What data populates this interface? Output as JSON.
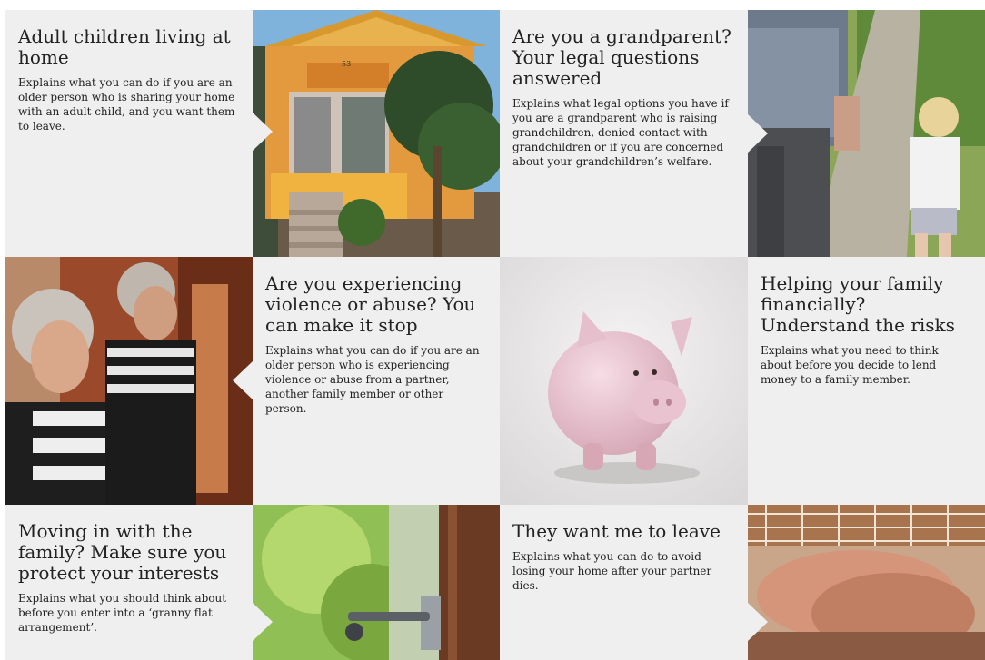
{
  "cards": [
    {
      "title": "Adult children living at home",
      "desc": "Explains what you can do if you are an older person who is sharing your home with an adult child, and you want them to leave."
    },
    {
      "title": "Are you a grandparent? Your legal questions answered",
      "desc": "Explains what legal options you have if you are a grandparent who is raising grandchildren, denied contact with grandchildren or if you are concerned about your grandchildren’s welfare."
    },
    {
      "title": "Are you experiencing violence or abuse? You can make it stop",
      "desc": "Explains what you can do if you are an older person who is experiencing violence or abuse from a partner, another family member or other person."
    },
    {
      "title": "Helping your family financially? Understand the risks",
      "desc": "Explains what you need to think about before you decide to lend money to a family member."
    },
    {
      "title": "Moving in with the family? Make sure you protect your interests",
      "desc": "Explains what you should think about before you enter into a ‘granny flat arrangement’."
    },
    {
      "title": "They want me to leave",
      "desc": "Explains what you can do to avoid losing your home after your partner dies."
    }
  ],
  "house_number": "53",
  "colors": {
    "panel": "#efefef",
    "text": "#222222"
  }
}
